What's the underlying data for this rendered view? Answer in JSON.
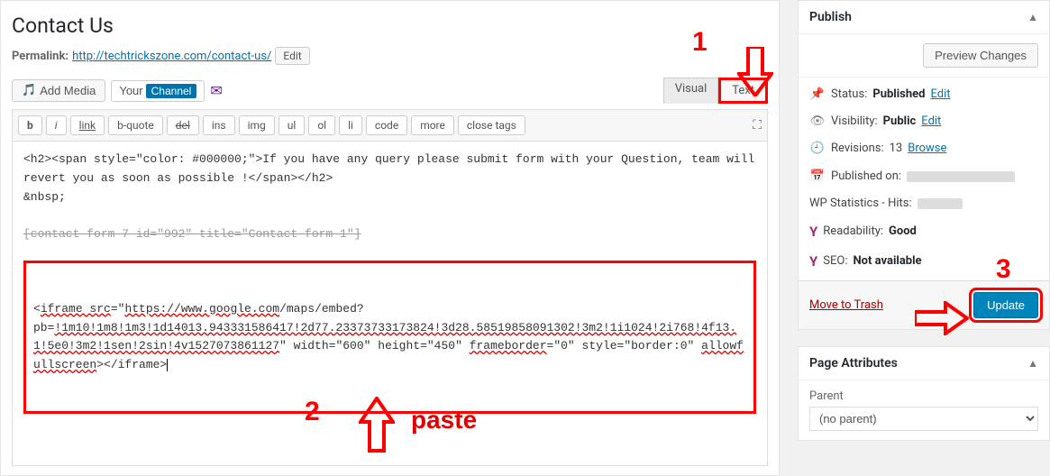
{
  "page": {
    "title": "Contact Us",
    "permalink_label": "Permalink:",
    "permalink_url": "http://techtrickszone.com/contact-us/",
    "edit_label": "Edit"
  },
  "toolbar": {
    "add_media": "Add Media",
    "channel_your": "Your",
    "channel_channel": "Channel",
    "visual_tab": "Visual",
    "text_tab": "Text"
  },
  "quicktags": {
    "b": "b",
    "i": "i",
    "link": "link",
    "bquote": "b-quote",
    "del": "del",
    "ins": "ins",
    "img": "img",
    "ul": "ul",
    "ol": "ol",
    "li": "li",
    "code": "code",
    "more": "more",
    "close": "close tags"
  },
  "editor": {
    "line1": "<h2><span style=\"color: #000000;\">If you have any query please submit form with your Question, team will revert you as soon as possible !</span></h2>",
    "line2": "&nbsp;",
    "line3_struck": "[contact-form-7 id=\"992\" title=\"Contact form 1\"]",
    "iframe_prefix": "<",
    "iframe_tag": "iframe src",
    "iframe_url_prefix": "=\"",
    "iframe_url_host": "https://www.google.com",
    "iframe_url_path": "/maps/embed?",
    "iframe_pb_prefix": "pb=",
    "iframe_pb_value": "!1m10!1m8!1m3!1d14013.943331586417!2d77.23373733173824!3d28.58519858091302!3m2!1i1024!2i768!4f13.1!5e0!3m2!1sen!2sin!4v1527073861127",
    "iframe_attrs_1": "\" width=\"600\" height=\"450\" ",
    "iframe_attr_fb": "frameborder",
    "iframe_attrs_2": "=\"0\" style=\"border:0\" ",
    "iframe_attr_afs": "allowfullscreen",
    "iframe_close": "></iframe>"
  },
  "annotations": {
    "num1": "1",
    "num2": "2",
    "num3": "3",
    "paste_label": "paste"
  },
  "publish": {
    "title": "Publish",
    "preview_changes": "Preview Changes",
    "status_label": "Status:",
    "status_value": "Published",
    "status_edit": "Edit",
    "visibility_label": "Visibility:",
    "visibility_value": "Public",
    "visibility_edit": "Edit",
    "revisions_label": "Revisions:",
    "revisions_count": "13",
    "revisions_browse": "Browse",
    "published_on_label": "Published on:",
    "wp_stats_label": "WP Statistics - Hits:",
    "readability_label": "Readability:",
    "readability_value": "Good",
    "seo_label": "SEO:",
    "seo_value": "Not available",
    "move_trash": "Move to Trash",
    "update": "Update"
  },
  "page_attributes": {
    "title": "Page Attributes",
    "parent_label": "Parent",
    "parent_value": "(no parent)"
  }
}
